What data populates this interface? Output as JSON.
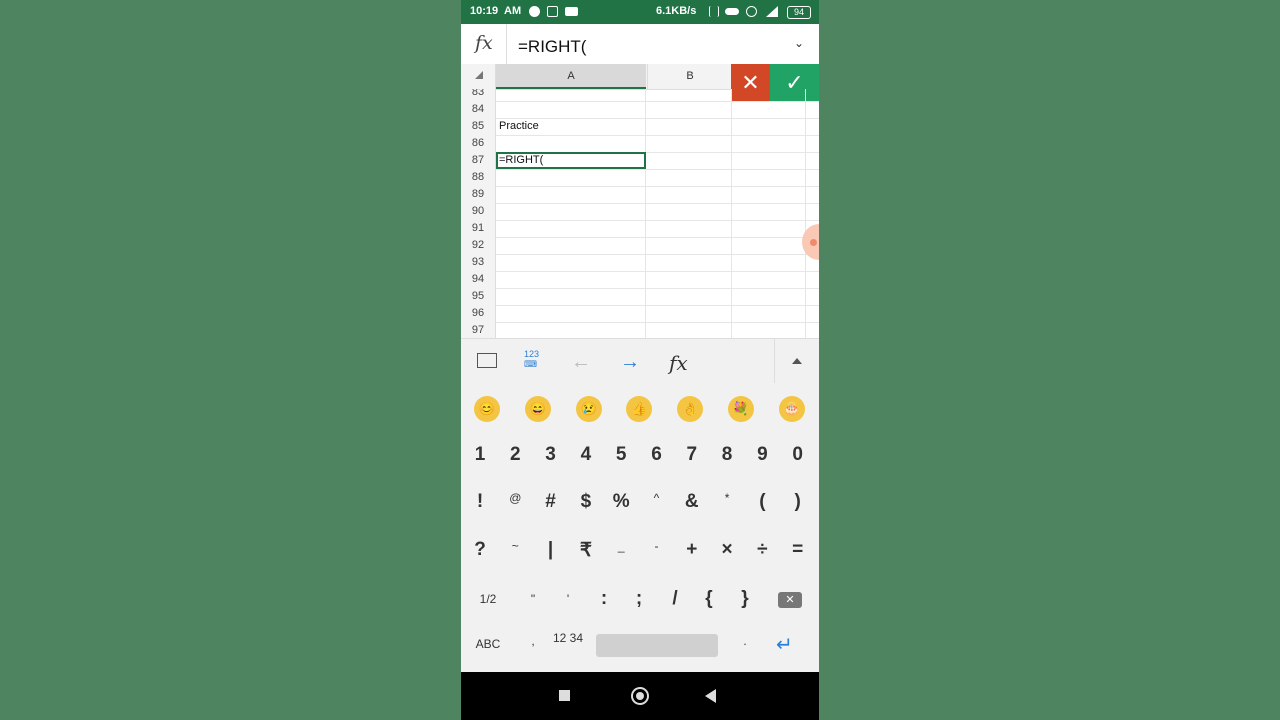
{
  "status_bar": {
    "time": "10:19",
    "ampm": "AM",
    "speed": "6.1KB/s",
    "battery": "94",
    "icons": [
      "messenger-icon",
      "alarm-sync-icon",
      "video-icon",
      "bluetooth-icon",
      "vibrate-icon",
      "alarm-icon",
      "signal-icon",
      "battery-icon"
    ]
  },
  "formula_bar": {
    "fx_label": "fx",
    "formula": "=RIGHT("
  },
  "grid": {
    "columns": [
      "A",
      "B"
    ],
    "rows": [
      {
        "num": "83",
        "a": ""
      },
      {
        "num": "84",
        "a": ""
      },
      {
        "num": "85",
        "a": "Practice"
      },
      {
        "num": "86",
        "a": ""
      },
      {
        "num": "87",
        "a": "=RIGHT("
      },
      {
        "num": "88",
        "a": ""
      },
      {
        "num": "89",
        "a": ""
      },
      {
        "num": "90",
        "a": ""
      },
      {
        "num": "91",
        "a": ""
      },
      {
        "num": "92",
        "a": ""
      },
      {
        "num": "93",
        "a": ""
      },
      {
        "num": "94",
        "a": ""
      },
      {
        "num": "95",
        "a": ""
      },
      {
        "num": "96",
        "a": ""
      },
      {
        "num": "97",
        "a": ""
      }
    ],
    "active_row": "87",
    "cancel_label": "✕",
    "confirm_label": "✓"
  },
  "toolbar": {
    "fx_label": "fx",
    "kbd_label": "123"
  },
  "emojis": [
    "😊",
    "😄",
    "😢",
    "👍",
    "👌",
    "💐",
    "🎂"
  ],
  "keyboard": {
    "row1": [
      "1",
      "2",
      "3",
      "4",
      "5",
      "6",
      "7",
      "8",
      "9",
      "0"
    ],
    "row2": [
      "!",
      "@",
      "#",
      "$",
      "%",
      "^",
      "&",
      "*",
      "(",
      ")"
    ],
    "row3": [
      "?",
      "~",
      "|",
      "₹",
      "_",
      "-",
      "+",
      "×",
      "÷",
      "="
    ],
    "row4": [
      "1/2",
      "\"",
      "'",
      ":",
      ";",
      "/",
      "{",
      "}"
    ],
    "bottom": {
      "abc": "ABC",
      "comma": ",",
      "numpad": "12 34",
      "period": ".",
      "enter": "↵"
    }
  },
  "colors": {
    "excel_green": "#217346",
    "cancel_red": "#d24726",
    "confirm_green": "#21a366",
    "background": "#4e8460"
  }
}
